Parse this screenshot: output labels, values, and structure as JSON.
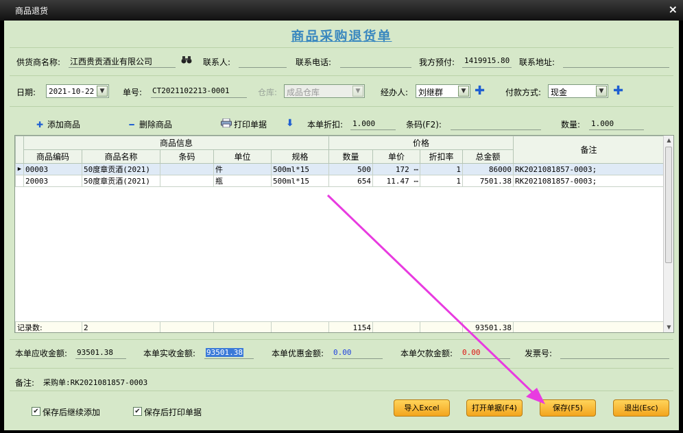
{
  "window": {
    "title": "商品退货",
    "close_glyph": "×"
  },
  "doc_title": "商品采购退货单",
  "row1": {
    "supplier_label": "供货商名称:",
    "supplier_value": "江西贵贡酒业有限公司",
    "search_icon": "binoculars-icon",
    "contact_label": "联系人:",
    "contact_value": "",
    "phone_label": "联系电话:",
    "phone_value": "",
    "prepay_label": "我方预付:",
    "prepay_value": "1419915.80",
    "address_label": "联系地址:",
    "address_value": ""
  },
  "row2": {
    "date_label": "日期:",
    "date_value": "2021-10-22",
    "no_label": "单号:",
    "no_value": "CT2021102213-0001",
    "warehouse_label": "仓库:",
    "warehouse_value": "成品仓库",
    "handler_label": "经办人:",
    "handler_value": "刘继群",
    "payment_label": "付款方式:",
    "payment_value": "现金"
  },
  "toolbar": {
    "add_label": "添加商品",
    "delete_label": "删除商品",
    "print_label": "打印单据",
    "discount_label": "本单折扣:",
    "discount_value": "1.000",
    "barcode_label": "条码(F2):",
    "barcode_value": "",
    "qty_label": "数量:",
    "qty_value": "1.000"
  },
  "grid": {
    "group_headers": {
      "info": "商品信息",
      "price": "价格",
      "remark": "备注"
    },
    "columns": [
      "商品编码",
      "商品名称",
      "条码",
      "单位",
      "规格",
      "数量",
      "单价",
      "折扣率",
      "总金额"
    ],
    "rows": [
      {
        "code": "00003",
        "name": "50度章贡酒(2021)",
        "barcode": "",
        "unit": "件",
        "spec": "500ml*15",
        "qty": "500",
        "price": "172",
        "discount": "1",
        "total": "86000",
        "remark": "RK2021081857-0003;"
      },
      {
        "code": "20003",
        "name": "50度章贡酒(2021)",
        "barcode": "",
        "unit": "瓶",
        "spec": "500ml*15",
        "qty": "654",
        "price": "11.47",
        "discount": "1",
        "total": "7501.38",
        "remark": "RK2021081857-0003;"
      }
    ],
    "footer": {
      "label": "记录数:",
      "count": "2",
      "qty_total": "1154",
      "amount_total": "93501.38"
    }
  },
  "summary": {
    "receivable_label": "本单应收金额:",
    "receivable_value": "93501.38",
    "actual_label": "本单实收金额:",
    "actual_value": "93501.38",
    "discount_label": "本单优惠金额:",
    "discount_value": "0.00",
    "owed_label": "本单欠款金额:",
    "owed_value": "0.00",
    "invoice_label": "发票号:",
    "invoice_value": ""
  },
  "remark": {
    "label": "备注:",
    "value": "采购单:RK2021081857-0003"
  },
  "options": {
    "continue_add_label": "保存后继续添加",
    "continue_add_checked": true,
    "print_after_label": "保存后打印单据",
    "print_after_checked": true
  },
  "buttons": {
    "import_excel": "导入Excel",
    "open_doc": "打开单据(F4)",
    "save": "保存(F5)",
    "exit": "退出(Esc)"
  },
  "colors": {
    "accent": "#3a88bf",
    "background": "#d6e8c9",
    "button": "#f3a51e",
    "annotation_arrow": "#e83be0"
  }
}
